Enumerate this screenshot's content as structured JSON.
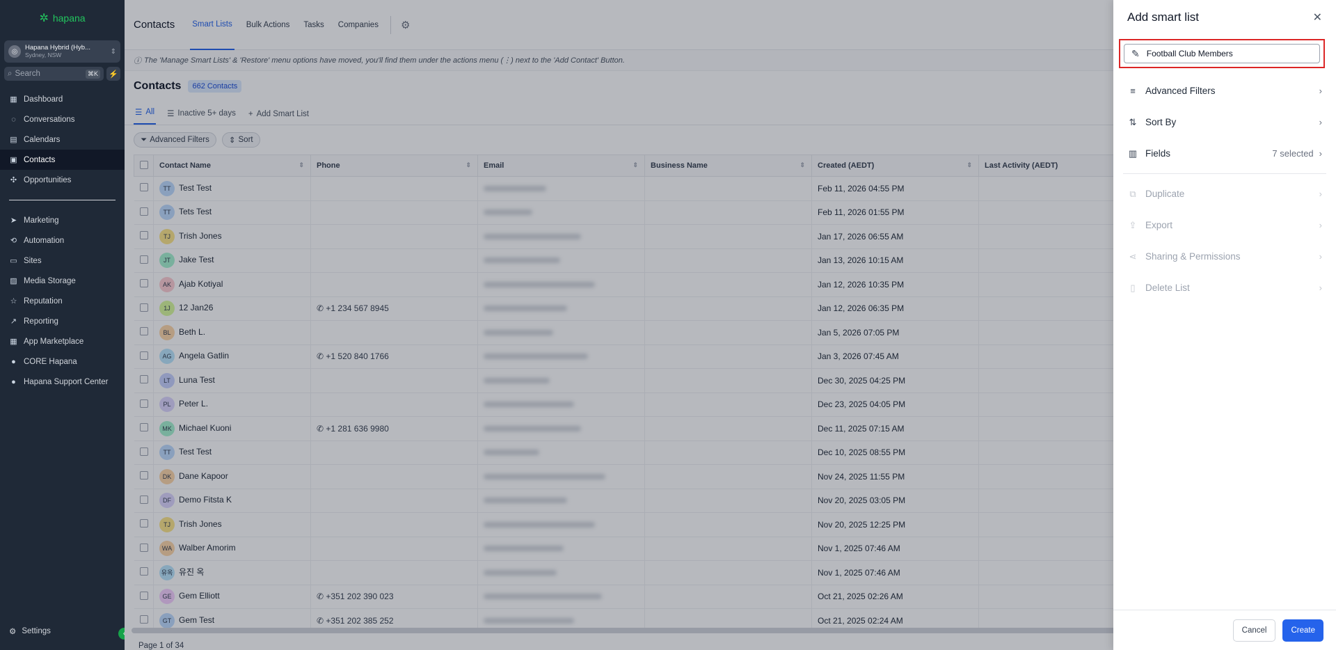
{
  "brand": {
    "logo_text": "hapana",
    "mark": "✲"
  },
  "account": {
    "name": "Hapana Hybrid (Hyb...",
    "location": "Sydney, NSW"
  },
  "search": {
    "placeholder": "Search",
    "shortcut": "⌘K"
  },
  "sidebar": {
    "items": [
      {
        "label": "Dashboard",
        "icon": "dashboard-icon",
        "glyph": "▦"
      },
      {
        "label": "Conversations",
        "icon": "chat-icon",
        "glyph": "◌"
      },
      {
        "label": "Calendars",
        "icon": "calendar-icon",
        "glyph": "▤"
      },
      {
        "label": "Contacts",
        "icon": "contacts-icon",
        "glyph": "▣"
      },
      {
        "label": "Opportunities",
        "icon": "opportunities-icon",
        "glyph": "✣"
      }
    ],
    "items2": [
      {
        "label": "Marketing",
        "icon": "send-icon",
        "glyph": "➤"
      },
      {
        "label": "Automation",
        "icon": "automation-icon",
        "glyph": "⟲"
      },
      {
        "label": "Sites",
        "icon": "sites-icon",
        "glyph": "▭"
      },
      {
        "label": "Media Storage",
        "icon": "image-icon",
        "glyph": "▨"
      },
      {
        "label": "Reputation",
        "icon": "star-icon",
        "glyph": "☆"
      },
      {
        "label": "Reporting",
        "icon": "trend-icon",
        "glyph": "↗"
      },
      {
        "label": "App Marketplace",
        "icon": "grid-icon",
        "glyph": "▦"
      },
      {
        "label": "CORE Hapana",
        "icon": "core-icon",
        "glyph": "●"
      },
      {
        "label": "Hapana Support Center",
        "icon": "support-icon",
        "glyph": "●"
      }
    ],
    "settings": "Settings"
  },
  "topbar": {
    "title": "Contacts",
    "tabs": [
      "Smart Lists",
      "Bulk Actions",
      "Tasks",
      "Companies"
    ]
  },
  "notice": "The 'Manage Smart Lists' & 'Restore' menu options have moved, you'll find them under the actions menu (⋮) next to the 'Add Contact' Button.",
  "heading": {
    "title": "Contacts",
    "count": "662 Contacts"
  },
  "view_tabs": [
    "All",
    "Inactive 5+ days",
    "Add Smart List"
  ],
  "filters": {
    "advanced": "Advanced Filters",
    "sort": "Sort"
  },
  "table": {
    "columns": [
      "Contact Name",
      "Phone",
      "Email",
      "Business Name",
      "Created (AEDT)",
      "Last Activity (AEDT)"
    ],
    "rows": [
      {
        "ini": "TT",
        "color": "#bfdbfe",
        "name": "Test Test",
        "phone": "",
        "created": "Feb 11, 2026 04:55 PM"
      },
      {
        "ini": "TT",
        "color": "#bfdbfe",
        "name": "Tets Test",
        "phone": "",
        "created": "Feb 11, 2026 01:55 PM"
      },
      {
        "ini": "TJ",
        "color": "#fde68a",
        "name": "Trish Jones",
        "phone": "",
        "created": "Jan 17, 2026 06:55 AM"
      },
      {
        "ini": "JT",
        "color": "#a7f3d0",
        "name": "Jake Test",
        "phone": "",
        "created": "Jan 13, 2026 10:15 AM"
      },
      {
        "ini": "AK",
        "color": "#fecdd3",
        "name": "Ajab Kotiyal",
        "phone": "",
        "created": "Jan 12, 2026 10:35 PM"
      },
      {
        "ini": "1J",
        "color": "#d9f99d",
        "name": "12 Jan26",
        "phone": "+1 234 567 8945",
        "created": "Jan 12, 2026 06:35 PM"
      },
      {
        "ini": "BL",
        "color": "#fed7aa",
        "name": "Beth L.",
        "phone": "",
        "created": "Jan 5, 2026 07:05 PM"
      },
      {
        "ini": "AG",
        "color": "#bae6fd",
        "name": "Angela Gatlin",
        "phone": "+1 520 840 1766",
        "created": "Jan 3, 2026 07:45 AM"
      },
      {
        "ini": "LT",
        "color": "#c7d2fe",
        "name": "Luna Test",
        "phone": "",
        "created": "Dec 30, 2025 04:25 PM"
      },
      {
        "ini": "PL",
        "color": "#ddd6fe",
        "name": "Peter L.",
        "phone": "",
        "created": "Dec 23, 2025 04:05 PM"
      },
      {
        "ini": "MK",
        "color": "#a7f3d0",
        "name": "Michael Kuoni",
        "phone": "+1 281 636 9980",
        "created": "Dec 11, 2025 07:15 AM"
      },
      {
        "ini": "TT",
        "color": "#bfdbfe",
        "name": "Test Test",
        "phone": "",
        "created": "Dec 10, 2025 08:55 PM"
      },
      {
        "ini": "DK",
        "color": "#fed7aa",
        "name": "Dane Kapoor",
        "phone": "",
        "created": "Nov 24, 2025 11:55 PM"
      },
      {
        "ini": "DF",
        "color": "#ddd6fe",
        "name": "Demo Fitsta K",
        "phone": "",
        "created": "Nov 20, 2025 03:05 PM"
      },
      {
        "ini": "TJ",
        "color": "#fde68a",
        "name": "Trish Jones",
        "phone": "",
        "created": "Nov 20, 2025 12:25 PM"
      },
      {
        "ini": "WA",
        "color": "#fed7aa",
        "name": "Walber Amorim",
        "phone": "",
        "created": "Nov 1, 2025 07:46 AM"
      },
      {
        "ini": "유옥",
        "color": "#bae6fd",
        "name": "유진 옥",
        "phone": "",
        "created": "Nov 1, 2025 07:46 AM"
      },
      {
        "ini": "GE",
        "color": "#f5d0fe",
        "name": "Gem Elliott",
        "phone": "+351 202 390 023",
        "created": "Oct 21, 2025 02:26 AM"
      },
      {
        "ini": "GT",
        "color": "#bfdbfe",
        "name": "Gem Test",
        "phone": "+351 202 385 252",
        "created": "Oct 21, 2025 02:24 AM"
      }
    ]
  },
  "pager": "Page 1 of 34",
  "drawer": {
    "title": "Add smart list",
    "name_value": "Football Club Members",
    "options": [
      {
        "label": "Advanced Filters",
        "right": ""
      },
      {
        "label": "Sort By",
        "right": ""
      },
      {
        "label": "Fields",
        "right": "7 selected"
      }
    ],
    "disabled": [
      "Duplicate",
      "Export",
      "Sharing & Permissions",
      "Delete List"
    ],
    "cancel": "Cancel",
    "create": "Create"
  }
}
